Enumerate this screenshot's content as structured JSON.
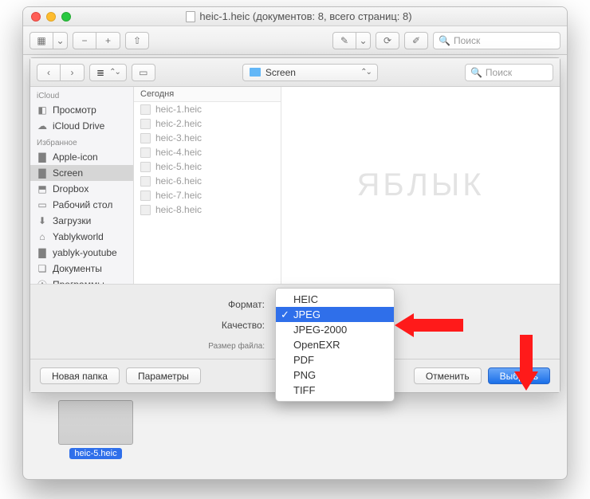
{
  "window": {
    "title": "heic-1.heic (документов: 8, всего страниц: 8)"
  },
  "toolbar": {
    "search_placeholder": "Поиск"
  },
  "sheet": {
    "location_folder": "Screen",
    "search_placeholder": "Поиск",
    "sidebar": {
      "section1": "iCloud",
      "items1": [
        {
          "label": "Просмотр",
          "icon": "preview-app-icon"
        },
        {
          "label": "iCloud Drive",
          "icon": "cloud-icon"
        }
      ],
      "section2": "Избранное",
      "items2": [
        {
          "label": "Apple-icon",
          "icon": "folder-icon"
        },
        {
          "label": "Screen",
          "icon": "folder-icon",
          "selected": true
        },
        {
          "label": "Dropbox",
          "icon": "dropbox-icon"
        },
        {
          "label": "Рабочий стол",
          "icon": "desktop-icon"
        },
        {
          "label": "Загрузки",
          "icon": "downloads-icon"
        },
        {
          "label": "Yablykworld",
          "icon": "home-icon"
        },
        {
          "label": "yablyk-youtube",
          "icon": "folder-icon"
        },
        {
          "label": "Документы",
          "icon": "documents-icon"
        },
        {
          "label": "Программы",
          "icon": "apps-icon"
        }
      ]
    },
    "file_list": {
      "header": "Сегодня",
      "items": [
        "heic-1.heic",
        "heic-2.heic",
        "heic-3.heic",
        "heic-4.heic",
        "heic-5.heic",
        "heic-6.heic",
        "heic-7.heic",
        "heic-8.heic"
      ]
    },
    "options": {
      "format_label": "Формат:",
      "quality_label": "Качество:",
      "filesize_label": "Размер файла:",
      "format_menu": [
        "HEIC",
        "JPEG",
        "JPEG-2000",
        "OpenEXR",
        "PDF",
        "PNG",
        "TIFF"
      ],
      "format_selected": "JPEG"
    },
    "footer": {
      "new_folder": "Новая папка",
      "params": "Параметры",
      "cancel": "Отменить",
      "choose": "Выбрать"
    }
  },
  "watermark": "ЯБЛЫК",
  "background_thumb": {
    "label": "heic-5.heic"
  }
}
